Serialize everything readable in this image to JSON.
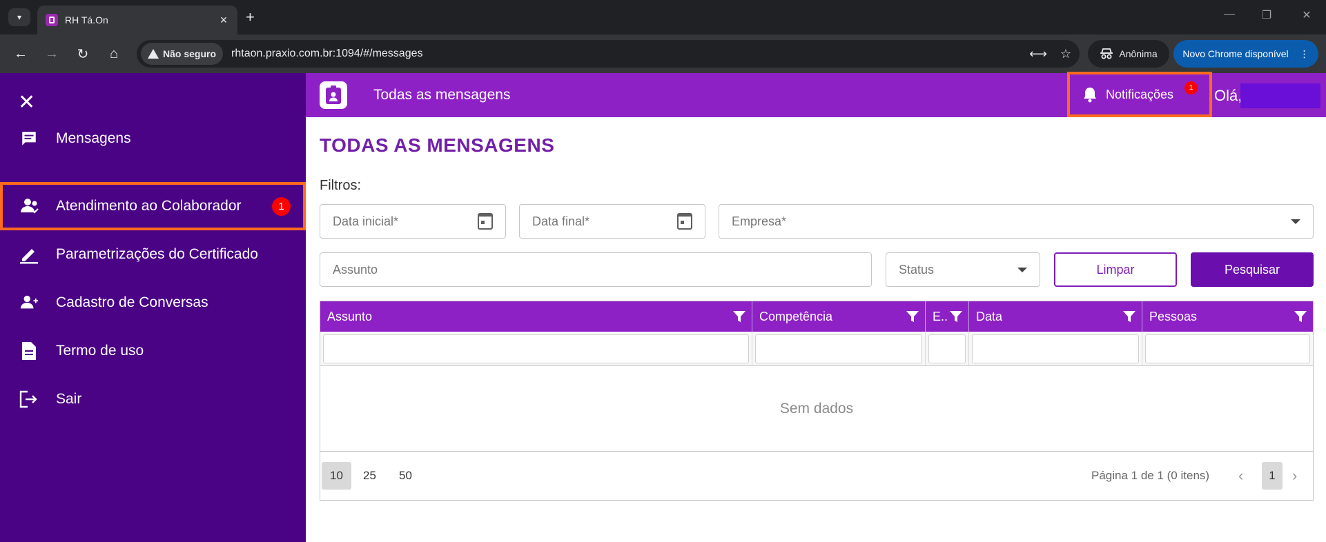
{
  "browser": {
    "tab_title": "RH Tá.On",
    "url": "rhtaon.praxio.com.br:1094/#/messages",
    "security_label": "Não seguro",
    "incognito_label": "Anônima",
    "update_label": "Novo Chrome disponível"
  },
  "sidebar": {
    "items": [
      {
        "label": "Mensagens",
        "icon": "chat-icon"
      },
      {
        "label": "Atendimento ao Colaborador",
        "icon": "users-support-icon",
        "badge": "1"
      },
      {
        "label": "Parametrizações do Certificado",
        "icon": "pen-icon"
      },
      {
        "label": "Cadastro de Conversas",
        "icon": "add-user-icon"
      },
      {
        "label": "Termo de uso",
        "icon": "document-icon"
      },
      {
        "label": "Sair",
        "icon": "logout-icon"
      }
    ]
  },
  "header": {
    "title": "Todas as mensagens",
    "notifications_label": "Notificações",
    "notifications_badge": "1",
    "greeting": "Olá,"
  },
  "main": {
    "page_title": "TODAS AS MENSAGENS",
    "filters_label": "Filtros:",
    "fields": {
      "start_date_placeholder": "Data inicial*",
      "end_date_placeholder": "Data final*",
      "company_placeholder": "Empresa*",
      "subject_placeholder": "Assunto",
      "status_placeholder": "Status"
    },
    "buttons": {
      "clear": "Limpar",
      "search": "Pesquisar"
    },
    "table": {
      "columns": [
        "Assunto",
        "Competência",
        "E..",
        "Data",
        "Pessoas"
      ],
      "empty_text": "Sem dados"
    },
    "pager": {
      "page_sizes": [
        "10",
        "25",
        "50"
      ],
      "info": "Página 1 de 1 (0 itens)",
      "current_page": "1"
    }
  },
  "colors": {
    "sidebar_bg": "#4a0385",
    "header_bg": "#8e21c5",
    "accent": "#6a0fad",
    "highlight_border": "#ff6a1f",
    "badge": "#ff0000"
  }
}
